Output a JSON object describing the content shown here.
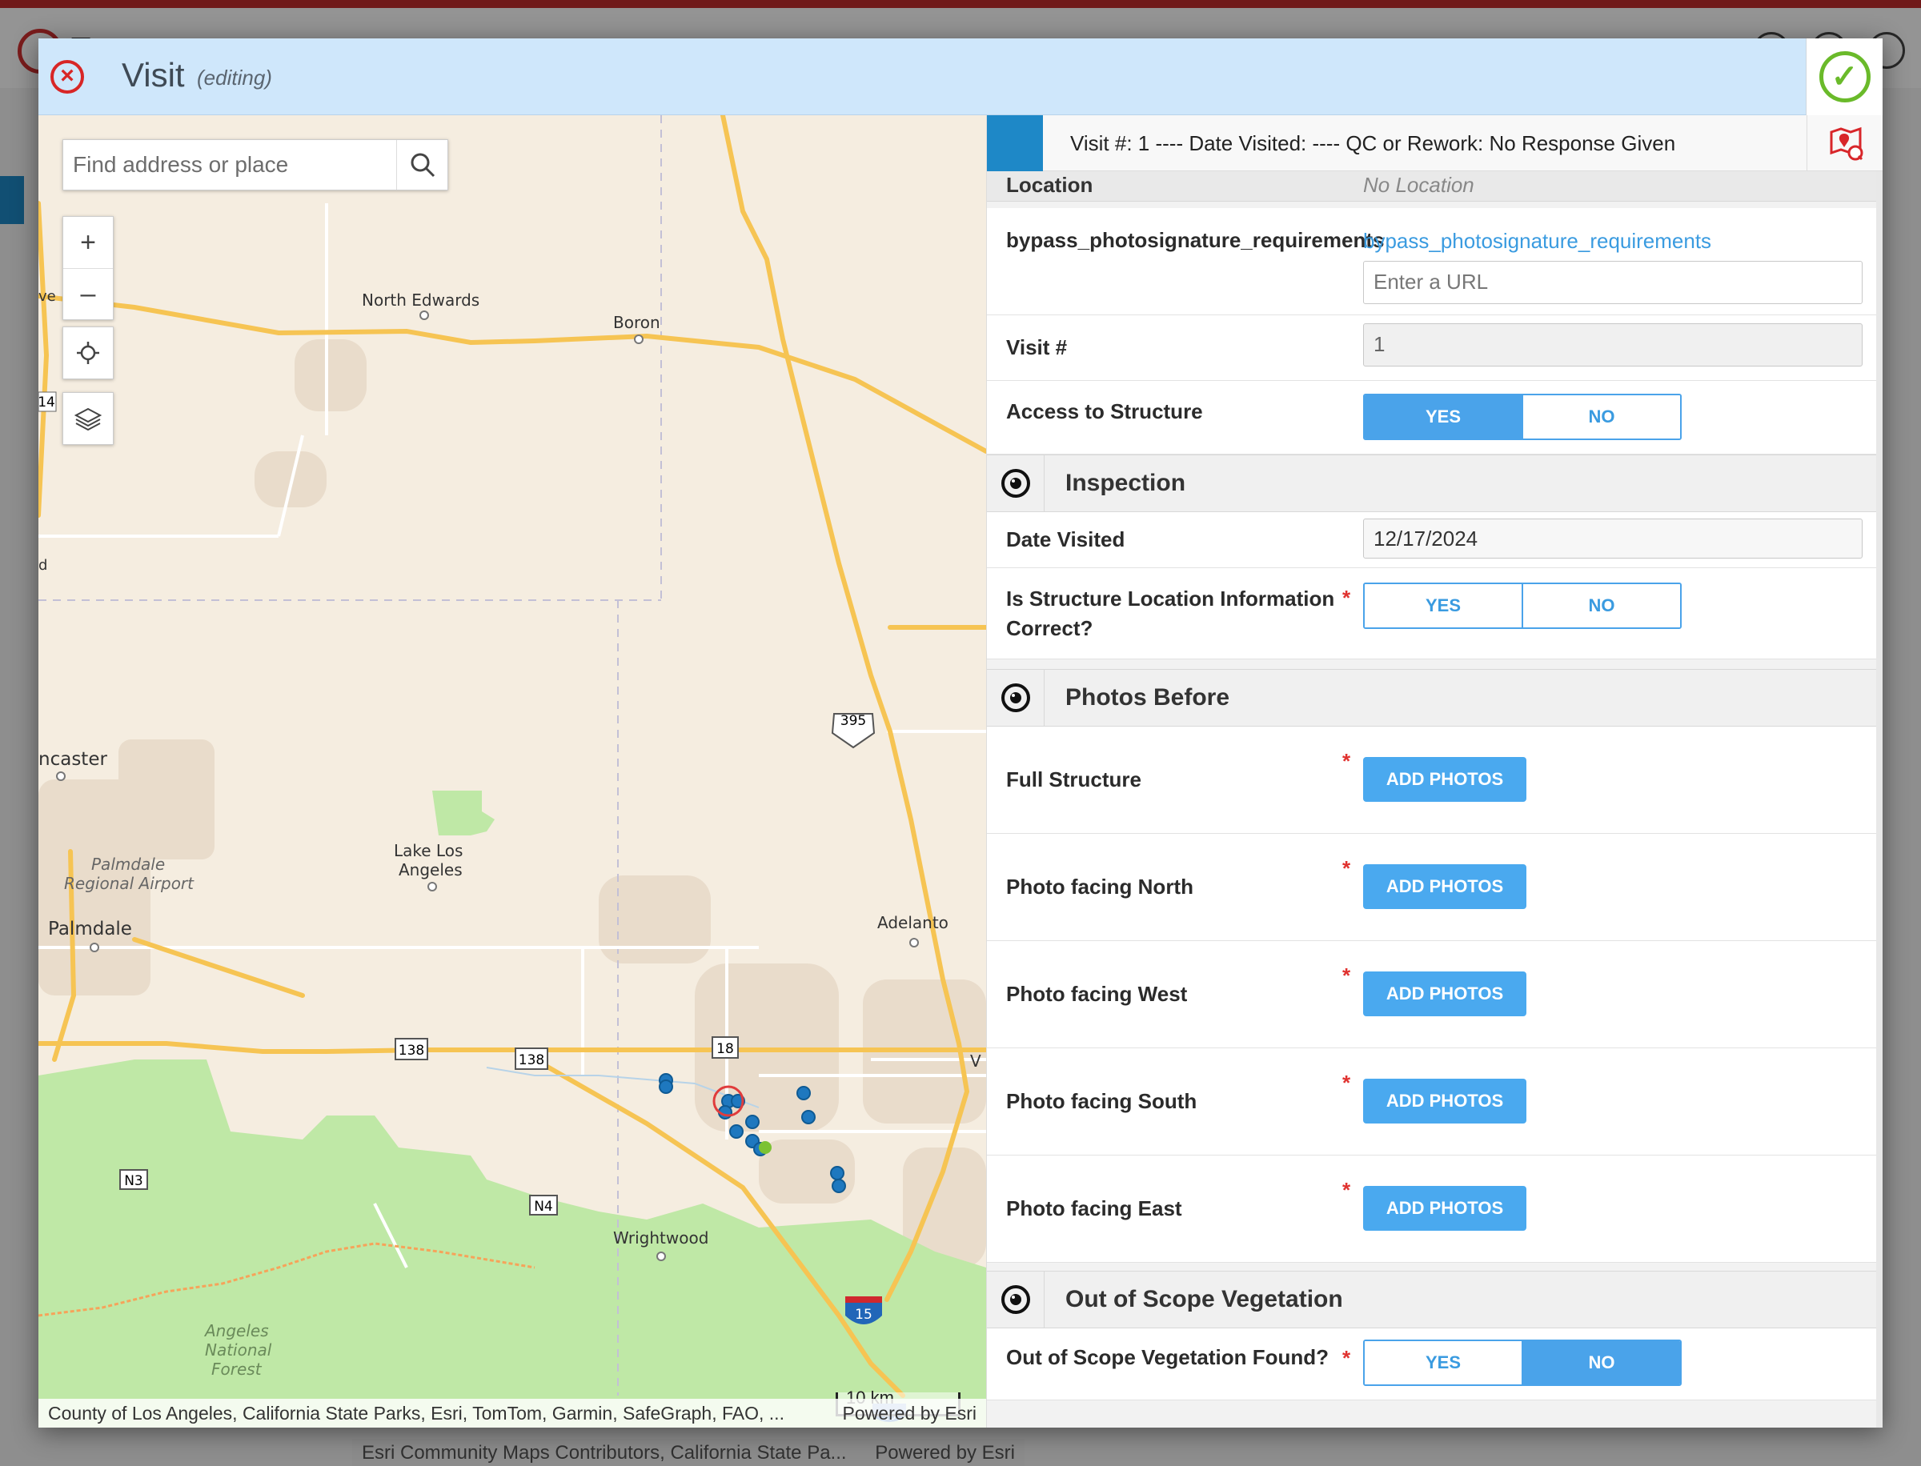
{
  "background_app": {
    "accent_color": "#c22b2b",
    "footer_attribution": "Esri Community Maps Contributors, California State Pa...",
    "footer_powered": "Powered by Esri"
  },
  "modal": {
    "title": "Visit",
    "subtitle": "(editing)",
    "close_icon": "close-circle-icon",
    "save_icon": "checkmark-circle-icon"
  },
  "map": {
    "search": {
      "placeholder": "Find address or place"
    },
    "tools": {
      "zoom_in": "+",
      "zoom_out": "–"
    },
    "places": {
      "north_edwards": "North Edwards",
      "boron": "Boron",
      "lancaster": "ncaster",
      "palmdale": "Palmdale",
      "palmdale_airport_1": "Palmdale",
      "palmdale_airport_2": "Regional Airport",
      "lake_los_angeles_1": "Lake Los",
      "lake_los_angeles_2": "Angeles",
      "adelanto": "Adelanto",
      "wrightwood": "Wrightwood",
      "angeles_forest_1": "Angeles",
      "angeles_forest_2": "National",
      "angeles_forest_3": "Forest",
      "edge_ve": "ve",
      "edge_d": "d",
      "edge_v": "V",
      "edge_14": "14"
    },
    "shields": {
      "us395": "395",
      "sr138a": "138",
      "sr138b": "138",
      "sr18": "18",
      "n3": "N3",
      "n4": "N4",
      "i15": "15",
      "i15b": "15"
    },
    "scale_label": "10 km",
    "attribution": "County of Los Angeles, California State Parks, Esri, TomTom, Garmin, SafeGraph, FAO, ...",
    "powered_by": "Powered by Esri",
    "colors": {
      "land": "#f5ede0",
      "forest": "#bfe8a6",
      "road": "#f6c453",
      "point": "#1e78bf"
    }
  },
  "form": {
    "visit_summary": "Visit #: 1 ---- Date Visited: ---- QC or Rework: No Response Given",
    "location_label": "Location",
    "location_value": "No Location",
    "bypass": {
      "label": "bypass_photosignature_requirements",
      "link": "bypass_photosignature_requirements",
      "url_placeholder": "Enter a URL"
    },
    "visit_number": {
      "label": "Visit #",
      "value": "1"
    },
    "access": {
      "label": "Access to Structure",
      "yes": "YES",
      "no": "NO",
      "selected": "YES"
    },
    "inspection": {
      "title": "Inspection",
      "date_label": "Date Visited",
      "date_value": "12/17/2024",
      "location_correct_label": "Is Structure Location Information Correct?",
      "yes": "YES",
      "no": "NO"
    },
    "photos_before": {
      "title": "Photos Before",
      "button": "ADD PHOTOS",
      "items": [
        "Full Structure",
        "Photo facing North",
        "Photo facing West",
        "Photo facing South",
        "Photo facing East"
      ]
    },
    "out_of_scope": {
      "title": "Out of Scope Vegetation",
      "found_label": "Out of Scope Vegetation Found?",
      "yes": "YES",
      "no": "NO",
      "selected": "NO"
    },
    "required_mark": "*",
    "colors": {
      "accent": "#4aa9ef",
      "required": "#e0322f"
    }
  }
}
